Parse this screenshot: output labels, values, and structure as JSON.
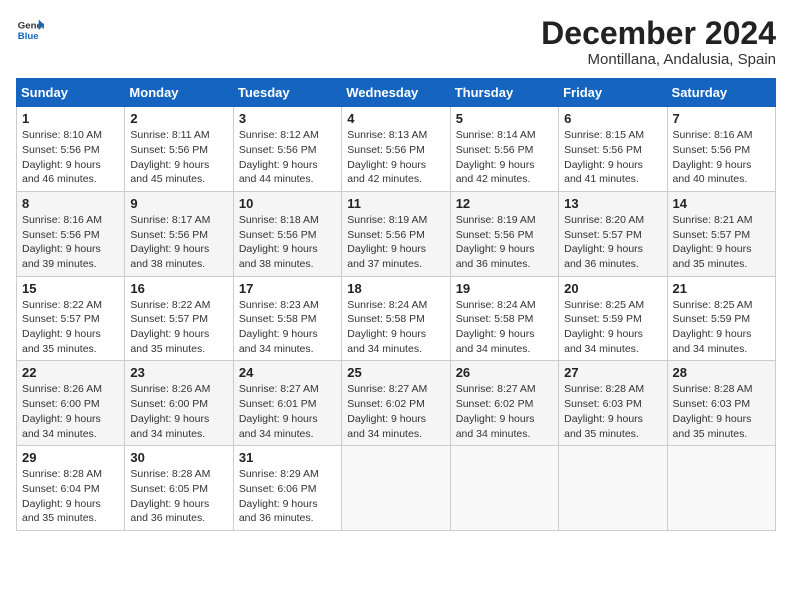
{
  "header": {
    "logo_general": "General",
    "logo_blue": "Blue",
    "month_title": "December 2024",
    "subtitle": "Montillana, Andalusia, Spain"
  },
  "weekdays": [
    "Sunday",
    "Monday",
    "Tuesday",
    "Wednesday",
    "Thursday",
    "Friday",
    "Saturday"
  ],
  "weeks": [
    [
      {
        "day": "1",
        "sunrise": "8:10 AM",
        "sunset": "5:56 PM",
        "daylight": "9 hours and 46 minutes."
      },
      {
        "day": "2",
        "sunrise": "8:11 AM",
        "sunset": "5:56 PM",
        "daylight": "9 hours and 45 minutes."
      },
      {
        "day": "3",
        "sunrise": "8:12 AM",
        "sunset": "5:56 PM",
        "daylight": "9 hours and 44 minutes."
      },
      {
        "day": "4",
        "sunrise": "8:13 AM",
        "sunset": "5:56 PM",
        "daylight": "9 hours and 42 minutes."
      },
      {
        "day": "5",
        "sunrise": "8:14 AM",
        "sunset": "5:56 PM",
        "daylight": "9 hours and 42 minutes."
      },
      {
        "day": "6",
        "sunrise": "8:15 AM",
        "sunset": "5:56 PM",
        "daylight": "9 hours and 41 minutes."
      },
      {
        "day": "7",
        "sunrise": "8:16 AM",
        "sunset": "5:56 PM",
        "daylight": "9 hours and 40 minutes."
      }
    ],
    [
      {
        "day": "8",
        "sunrise": "8:16 AM",
        "sunset": "5:56 PM",
        "daylight": "9 hours and 39 minutes."
      },
      {
        "day": "9",
        "sunrise": "8:17 AM",
        "sunset": "5:56 PM",
        "daylight": "9 hours and 38 minutes."
      },
      {
        "day": "10",
        "sunrise": "8:18 AM",
        "sunset": "5:56 PM",
        "daylight": "9 hours and 38 minutes."
      },
      {
        "day": "11",
        "sunrise": "8:19 AM",
        "sunset": "5:56 PM",
        "daylight": "9 hours and 37 minutes."
      },
      {
        "day": "12",
        "sunrise": "8:19 AM",
        "sunset": "5:56 PM",
        "daylight": "9 hours and 36 minutes."
      },
      {
        "day": "13",
        "sunrise": "8:20 AM",
        "sunset": "5:57 PM",
        "daylight": "9 hours and 36 minutes."
      },
      {
        "day": "14",
        "sunrise": "8:21 AM",
        "sunset": "5:57 PM",
        "daylight": "9 hours and 35 minutes."
      }
    ],
    [
      {
        "day": "15",
        "sunrise": "8:22 AM",
        "sunset": "5:57 PM",
        "daylight": "9 hours and 35 minutes."
      },
      {
        "day": "16",
        "sunrise": "8:22 AM",
        "sunset": "5:57 PM",
        "daylight": "9 hours and 35 minutes."
      },
      {
        "day": "17",
        "sunrise": "8:23 AM",
        "sunset": "5:58 PM",
        "daylight": "9 hours and 34 minutes."
      },
      {
        "day": "18",
        "sunrise": "8:24 AM",
        "sunset": "5:58 PM",
        "daylight": "9 hours and 34 minutes."
      },
      {
        "day": "19",
        "sunrise": "8:24 AM",
        "sunset": "5:58 PM",
        "daylight": "9 hours and 34 minutes."
      },
      {
        "day": "20",
        "sunrise": "8:25 AM",
        "sunset": "5:59 PM",
        "daylight": "9 hours and 34 minutes."
      },
      {
        "day": "21",
        "sunrise": "8:25 AM",
        "sunset": "5:59 PM",
        "daylight": "9 hours and 34 minutes."
      }
    ],
    [
      {
        "day": "22",
        "sunrise": "8:26 AM",
        "sunset": "6:00 PM",
        "daylight": "9 hours and 34 minutes."
      },
      {
        "day": "23",
        "sunrise": "8:26 AM",
        "sunset": "6:00 PM",
        "daylight": "9 hours and 34 minutes."
      },
      {
        "day": "24",
        "sunrise": "8:27 AM",
        "sunset": "6:01 PM",
        "daylight": "9 hours and 34 minutes."
      },
      {
        "day": "25",
        "sunrise": "8:27 AM",
        "sunset": "6:02 PM",
        "daylight": "9 hours and 34 minutes."
      },
      {
        "day": "26",
        "sunrise": "8:27 AM",
        "sunset": "6:02 PM",
        "daylight": "9 hours and 34 minutes."
      },
      {
        "day": "27",
        "sunrise": "8:28 AM",
        "sunset": "6:03 PM",
        "daylight": "9 hours and 35 minutes."
      },
      {
        "day": "28",
        "sunrise": "8:28 AM",
        "sunset": "6:03 PM",
        "daylight": "9 hours and 35 minutes."
      }
    ],
    [
      {
        "day": "29",
        "sunrise": "8:28 AM",
        "sunset": "6:04 PM",
        "daylight": "9 hours and 35 minutes."
      },
      {
        "day": "30",
        "sunrise": "8:28 AM",
        "sunset": "6:05 PM",
        "daylight": "9 hours and 36 minutes."
      },
      {
        "day": "31",
        "sunrise": "8:29 AM",
        "sunset": "6:06 PM",
        "daylight": "9 hours and 36 minutes."
      },
      null,
      null,
      null,
      null
    ]
  ],
  "labels": {
    "sunrise_label": "Sunrise:",
    "sunset_label": "Sunset:",
    "daylight_label": "Daylight:"
  }
}
